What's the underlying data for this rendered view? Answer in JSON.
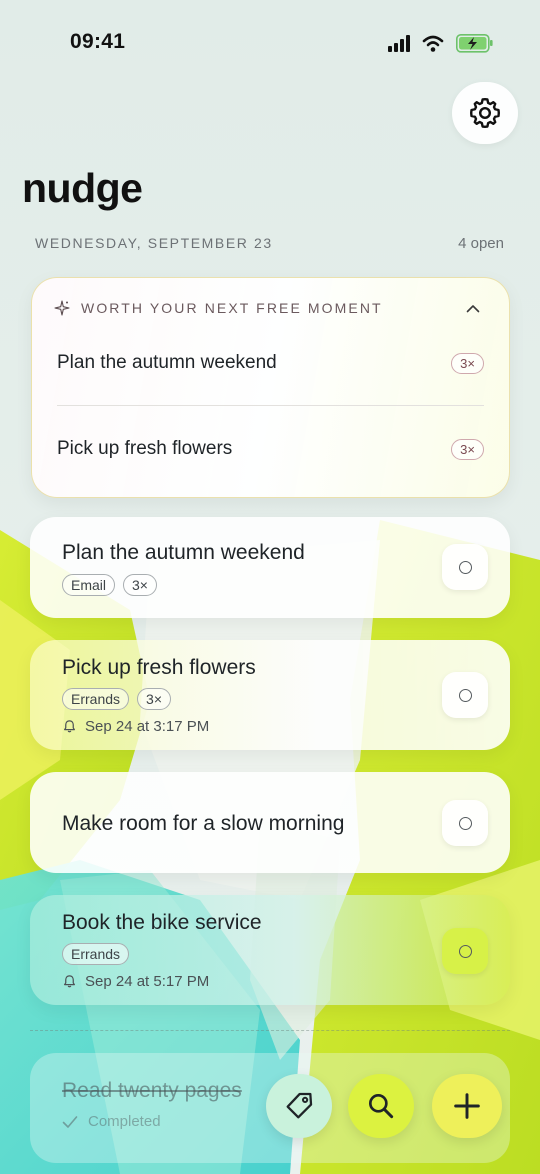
{
  "status_bar": {
    "time": "09:41"
  },
  "header": {
    "app_title": "nudge",
    "date": "WEDNESDAY, SEPTEMBER 23",
    "open_count": "4 open",
    "settings_icon": "gear-icon"
  },
  "suggestions": {
    "heading": "WORTH YOUR NEXT FREE MOMENT",
    "items": [
      {
        "title": "Plan the autumn weekend",
        "count": "3×"
      },
      {
        "title": "Pick up fresh flowers",
        "count": "3×"
      }
    ]
  },
  "tasks": [
    {
      "title": "Plan the autumn weekend",
      "tags": [
        "Email",
        "3×"
      ],
      "reminder": ""
    },
    {
      "title": "Pick up fresh flowers",
      "tags": [
        "Errands",
        "3×"
      ],
      "reminder": "Sep 24 at 3:17 PM"
    },
    {
      "title": "Make room for a slow morning",
      "tags": [],
      "reminder": ""
    },
    {
      "title": "Book the bike service",
      "tags": [
        "Errands"
      ],
      "reminder": "Sep 24 at 5:17 PM"
    }
  ],
  "completed": [
    {
      "title": "Read twenty pages",
      "status": "Completed"
    }
  ],
  "fab": {
    "tag_icon": "tag-icon",
    "search_icon": "search-icon",
    "add_icon": "plus-icon"
  },
  "colors": {
    "lime": "#d7f046",
    "yellow": "#eef05a",
    "teal": "#6ee0d2",
    "mint": "#c9f2dc"
  }
}
